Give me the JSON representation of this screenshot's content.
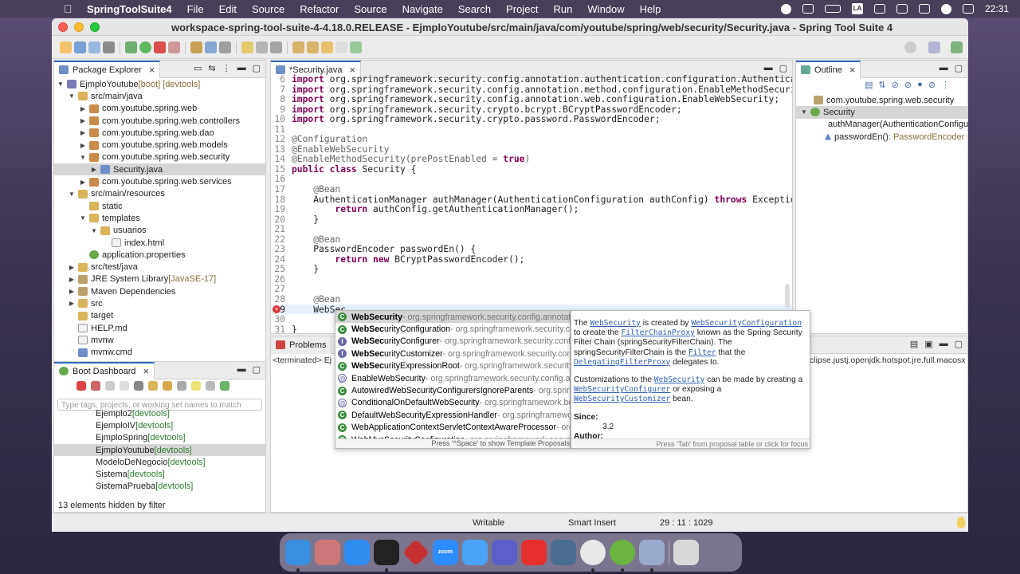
{
  "menubar": {
    "app": "SpringToolSuite4",
    "items": [
      "File",
      "Edit",
      "Source",
      "Refactor",
      "Source",
      "Navigate",
      "Search",
      "Project",
      "Run",
      "Window",
      "Help"
    ],
    "input_source": "LA",
    "clock": "22:31"
  },
  "window": {
    "title": "workspace-spring-tool-suite-4-4.18.0.RELEASE - EjmploYoutube/src/main/java/com/youtube/spring/web/security/Security.java - Spring Tool Suite 4"
  },
  "package_explorer": {
    "tab": "Package Explorer",
    "rows": [
      {
        "label": "EjmploYoutube",
        "suffix": " [boot] [devtools]"
      },
      {
        "label": "src/main/java",
        "suffix": ""
      },
      {
        "label": "com.youtube.spring.web",
        "suffix": ""
      },
      {
        "label": "com.youtube.spring.web.controllers",
        "suffix": ""
      },
      {
        "label": "com.youtube.spring.web.dao",
        "suffix": ""
      },
      {
        "label": "com.youtube.spring.web.models",
        "suffix": ""
      },
      {
        "label": "com.youtube.spring.web.security",
        "suffix": ""
      },
      {
        "label": "Security.java",
        "suffix": ""
      },
      {
        "label": "com.youtube.spring.web.services",
        "suffix": ""
      },
      {
        "label": "src/main/resources",
        "suffix": ""
      },
      {
        "label": "static",
        "suffix": ""
      },
      {
        "label": "templates",
        "suffix": ""
      },
      {
        "label": "usuarios",
        "suffix": ""
      },
      {
        "label": "index.html",
        "suffix": ""
      },
      {
        "label": "application.properties",
        "suffix": ""
      },
      {
        "label": "src/test/java",
        "suffix": ""
      },
      {
        "label": "JRE System Library",
        "suffix": " [JavaSE-17]"
      },
      {
        "label": "Maven Dependencies",
        "suffix": ""
      },
      {
        "label": "src",
        "suffix": ""
      },
      {
        "label": "target",
        "suffix": ""
      },
      {
        "label": "HELP.md",
        "suffix": ""
      },
      {
        "label": "mvnw",
        "suffix": ""
      },
      {
        "label": "mvnw.cmd",
        "suffix": ""
      }
    ]
  },
  "boot_dashboard": {
    "tab": "Boot Dashboard",
    "search_placeholder": "Type tags, projects, or working set names to match",
    "rows": [
      {
        "label": "Ejemplo2",
        "suffix": " [devtools]"
      },
      {
        "label": "EjemploIV",
        "suffix": " [devtools]"
      },
      {
        "label": "EjmploSpring",
        "suffix": " [devtools]"
      },
      {
        "label": "EjmploYoutube",
        "suffix": " [devtools]"
      },
      {
        "label": "ModeloDeNegocio",
        "suffix": " [devtools]"
      },
      {
        "label": "Sistema",
        "suffix": " [devtools]"
      },
      {
        "label": "SistemaPrueba",
        "suffix": " [devtools]"
      }
    ],
    "footer": "13 elements hidden by filter"
  },
  "editor": {
    "tab": "*Security.java",
    "lines": [
      {
        "n": "6",
        "text": "import org.springframework.security.config.annotation.authentication.configuration.Authenticat"
      },
      {
        "n": "7",
        "text": "import org.springframework.security.config.annotation.method.configuration.EnableMethodSecuri"
      },
      {
        "n": "8",
        "text": "import org.springframework.security.config.annotation.web.configuration.EnableWebSecurity;"
      },
      {
        "n": "9",
        "text": "import org.springframework.security.crypto.bcrypt.BCryptPasswordEncoder;"
      },
      {
        "n": "10",
        "text": "import org.springframework.security.crypto.password.PasswordEncoder;"
      },
      {
        "n": "11",
        "text": ""
      },
      {
        "n": "12",
        "text": "@Configuration"
      },
      {
        "n": "13",
        "text": "@EnableWebSecurity"
      },
      {
        "n": "14",
        "text": "@EnableMethodSecurity(prePostEnabled = true)"
      },
      {
        "n": "15",
        "text": "public class Security {"
      },
      {
        "n": "16",
        "text": ""
      },
      {
        "n": "17",
        "text": "    @Bean"
      },
      {
        "n": "18",
        "text": "    AuthenticationManager authManager(AuthenticationConfiguration authConfig) throws Exception"
      },
      {
        "n": "19",
        "text": "        return authConfig.getAuthenticationManager();"
      },
      {
        "n": "20",
        "text": "    }"
      },
      {
        "n": "21",
        "text": ""
      },
      {
        "n": "22",
        "text": "    @Bean"
      },
      {
        "n": "23",
        "text": "    PasswordEncoder passwordEn() {"
      },
      {
        "n": "24",
        "text": "        return new BCryptPasswordEncoder();"
      },
      {
        "n": "25",
        "text": "    }"
      },
      {
        "n": "26",
        "text": ""
      },
      {
        "n": "27",
        "text": ""
      },
      {
        "n": "28",
        "text": "    @Bean"
      },
      {
        "n": "29",
        "text": "    WebSec"
      },
      {
        "n": "30",
        "text": ""
      },
      {
        "n": "31",
        "text": "}"
      }
    ]
  },
  "completion": {
    "items": [
      {
        "bold": "WebSec",
        "rest": "urity",
        "qual": " - org.springframework.security.config.annotation.web.builders",
        "icon": "c"
      },
      {
        "bold": "WebSec",
        "rest": "urityConfiguration",
        "qual": " - org.springframework.security.config.annotation.web.configuration",
        "icon": "c"
      },
      {
        "bold": "WebSec",
        "rest": "urityConfigurer",
        "qual": " - org.springframework.security.config.annotation.web",
        "icon": "i"
      },
      {
        "bold": "WebSec",
        "rest": "urityCustomizer",
        "qual": " - org.springframework.security.config.annotation.web.configuration",
        "icon": "i"
      },
      {
        "bold": "WebSec",
        "rest": "urityExpressionRoot",
        "qual": " - org.springframework.security.web.access.expression",
        "icon": "c"
      },
      {
        "bold": "",
        "rest": "EnableWebSecurity",
        "qual": " - org.springframework.security.config.annotation.web.configuration",
        "icon": "a"
      },
      {
        "bold": "",
        "rest": "AutowiredWebSecurityConfigurersIgnoreParents",
        "qual": " - org.springframework.security.config",
        "icon": "c"
      },
      {
        "bold": "",
        "rest": "ConditionalOnDefaultWebSecurity",
        "qual": " - org.springframework.boot.autoconfigure.security",
        "icon": "a"
      },
      {
        "bold": "",
        "rest": "DefaultWebSecurityExpressionHandler",
        "qual": " - org.springframework.security.web.access",
        "icon": "c"
      },
      {
        "bold": "",
        "rest": "WebApplicationContextServletContextAwareProcessor",
        "qual": " - org.springframework",
        "icon": "c"
      },
      {
        "bold": "",
        "rest": "WebMvcSecurityConfiguration",
        "qual": " - org.springframework.security.config.annotation",
        "icon": "c"
      }
    ],
    "footer": "Press '^Space' to show Template Proposals"
  },
  "javadoc": {
    "p1a": "The ",
    "p1b": "WebSecurity",
    "p1c": " is created by ",
    "p1d": "WebSecurityConfiguration",
    "p1e": " to create the ",
    "p1f": "FilterChainProxy",
    "p1g": " known as the Spring Security Filter Chain (springSecurityFilterChain). The springSecurityFilterChain is the ",
    "p1h": "Filter",
    "p1i": " that the ",
    "p1j": "DelegatingFilterProxy",
    "p1k": " delegates to.",
    "p2a": "Customizations to the ",
    "p2b": "WebSecurity",
    "p2c": " can be made by creating a ",
    "p2d": "WebSecurityConfigurer",
    "p2e": " or exposing a ",
    "p2f": "WebSecurityCustomizer",
    "p2g": " bean.",
    "since_label": "Since:",
    "since": "3.2",
    "author_label": "Author:",
    "footer": "Press 'Tab' from proposal table or click for focus"
  },
  "outline": {
    "tab": "Outline",
    "rows": [
      {
        "label": "com.youtube.spring.web.security",
        "suffix": ""
      },
      {
        "label": "Security",
        "suffix": ""
      },
      {
        "label": "authManager(AuthenticationConfiguration)",
        "suffix": ""
      },
      {
        "label": "passwordEn()",
        "suffix": " : PasswordEncoder"
      }
    ]
  },
  "console": {
    "tab": "Problems",
    "terminated": "<terminated> Ej",
    "right_text": "clipse.justj.openjdk.hotspot.jre.full.macosx"
  },
  "status": {
    "writable": "Writable",
    "insert": "Smart Insert",
    "position": "29 : 11 : 1029"
  },
  "dock": {
    "zoom_label": "zoom"
  }
}
